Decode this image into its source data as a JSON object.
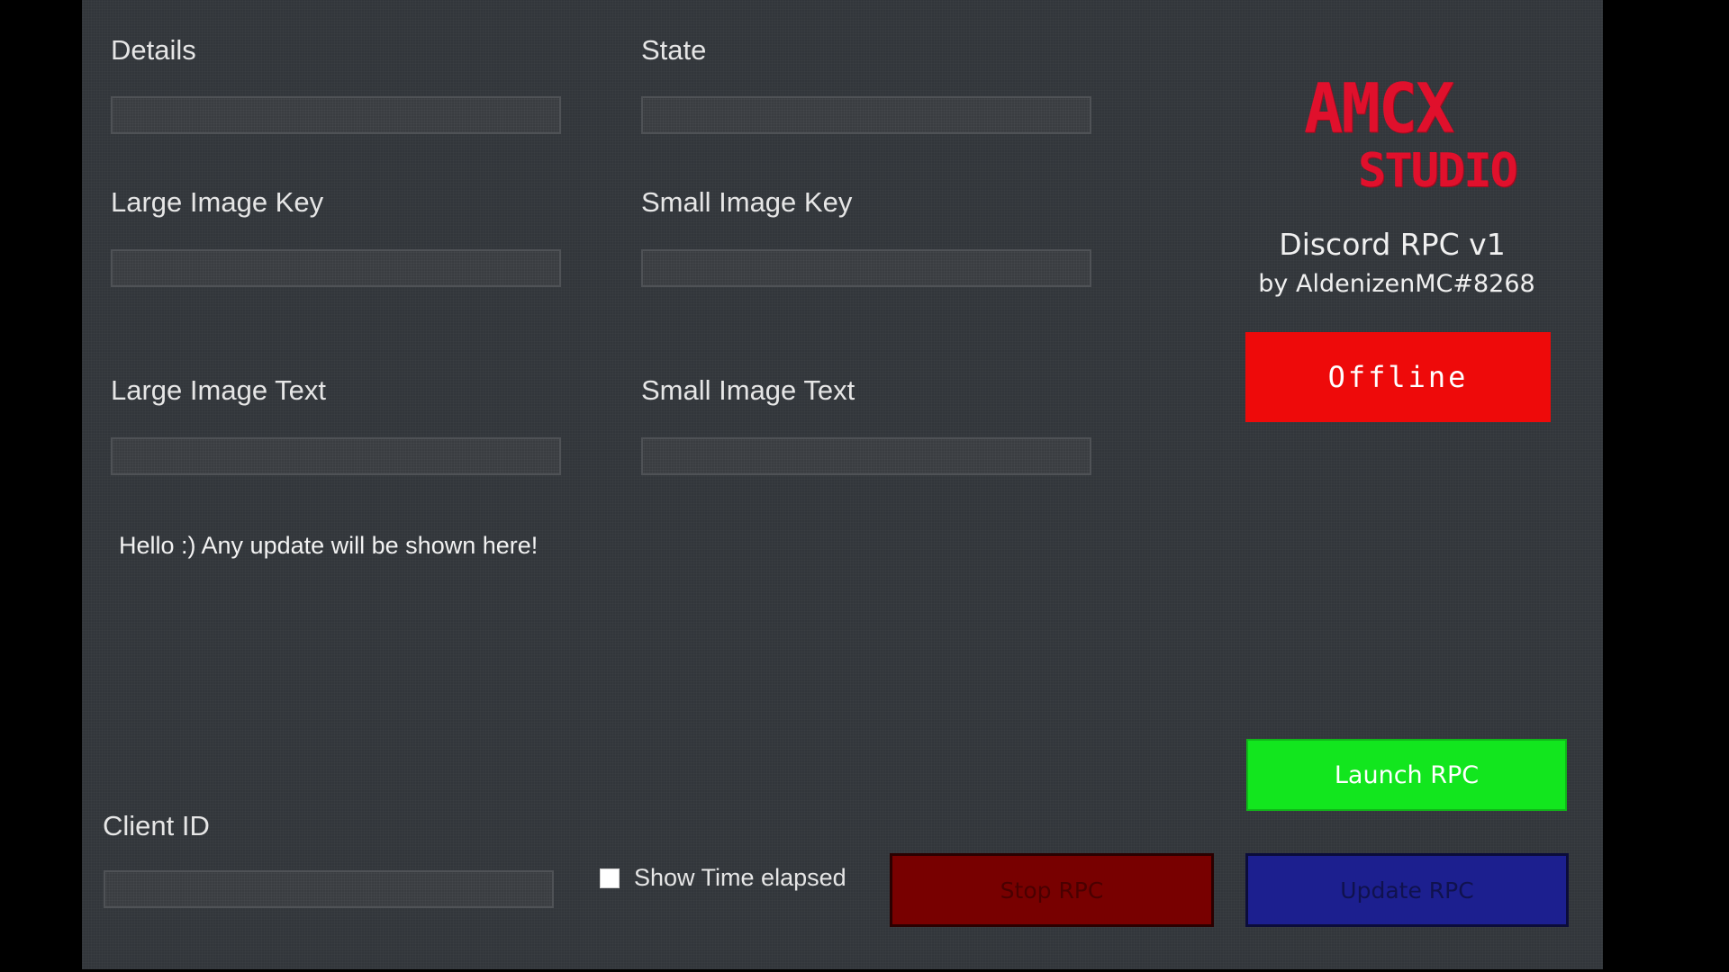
{
  "form": {
    "details": {
      "label": "Details",
      "value": ""
    },
    "state": {
      "label": "State",
      "value": ""
    },
    "large_image_key": {
      "label": "Large Image Key",
      "value": ""
    },
    "small_image_key": {
      "label": "Small Image Key",
      "value": ""
    },
    "large_image_text": {
      "label": "Large Image Text",
      "value": ""
    },
    "small_image_text": {
      "label": "Small Image Text",
      "value": ""
    },
    "client_id": {
      "label": "Client ID",
      "value": ""
    }
  },
  "logo": {
    "line1": "AMCX",
    "line2": "STUDIO"
  },
  "app": {
    "title": "Discord RPC v1",
    "author": "by AldenizenMC#8268"
  },
  "status": {
    "text": "Offline",
    "color": "#ee0a0a"
  },
  "update_message": "Hello :) Any update will be shown here!",
  "options": {
    "show_time_elapsed": {
      "label": "Show Time elapsed",
      "checked": false
    }
  },
  "buttons": {
    "launch": "Launch RPC",
    "stop": "Stop RPC",
    "update": "Update RPC"
  },
  "colors": {
    "background": "#32363b",
    "launch": "#12e61e",
    "stop": "#780000",
    "update": "#1c1f8f",
    "logo": "#e0102c"
  }
}
